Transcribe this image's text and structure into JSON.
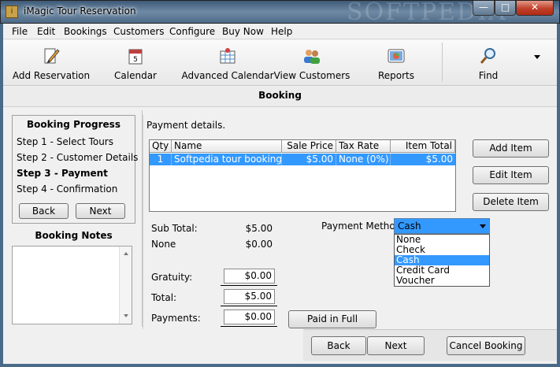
{
  "window": {
    "title": "iMagic Tour Reservation",
    "watermark": "SOFTPEDIA",
    "min": "—",
    "max": "□",
    "close": "✕"
  },
  "menu": [
    "File",
    "Edit",
    "Bookings",
    "Customers",
    "Configure",
    "Buy Now",
    "Help"
  ],
  "toolbar": {
    "add_reservation": "Add Reservation",
    "calendar": "Calendar",
    "advanced_calendar": "Advanced Calendar",
    "view_customers": "View Customers",
    "reports": "Reports",
    "find": "Find"
  },
  "section_title": "Booking",
  "progress": {
    "title": "Booking Progress",
    "steps": [
      "Step 1 - Select Tours",
      "Step 2 - Customer Details",
      "Step 3 - Payment",
      "Step 4 - Confirmation"
    ],
    "back": "Back",
    "next": "Next"
  },
  "notes": {
    "title": "Booking Notes"
  },
  "payment": {
    "details_label": "Payment details.",
    "columns": [
      "Qty",
      "Name",
      "Sale Price",
      "Tax Rate",
      "Item Total"
    ],
    "rows": [
      {
        "qty": "1",
        "name": "Softpedia tour booking from",
        "sale_price": "$5.00",
        "tax_rate": "None (0%)",
        "item_total": "$5.00"
      }
    ],
    "add_item": "Add Item",
    "edit_item": "Edit Item",
    "delete_item": "Delete Item",
    "sub_total_label": "Sub Total:",
    "sub_total": "$5.00",
    "tax_label": "None",
    "tax": "$0.00",
    "gratuity_label": "Gratuity:",
    "gratuity": "$0.00",
    "total_label": "Total:",
    "total": "$5.00",
    "payments_label": "Payments:",
    "payments": "$0.00",
    "paid_in_full": "Paid in Full",
    "method_label": "Payment Method:",
    "method_selected": "Cash",
    "method_options": [
      "None",
      "Check",
      "Cash",
      "Credit Card",
      "Voucher"
    ]
  },
  "nav": {
    "back": "Back",
    "next": "Next",
    "cancel": "Cancel Booking"
  }
}
